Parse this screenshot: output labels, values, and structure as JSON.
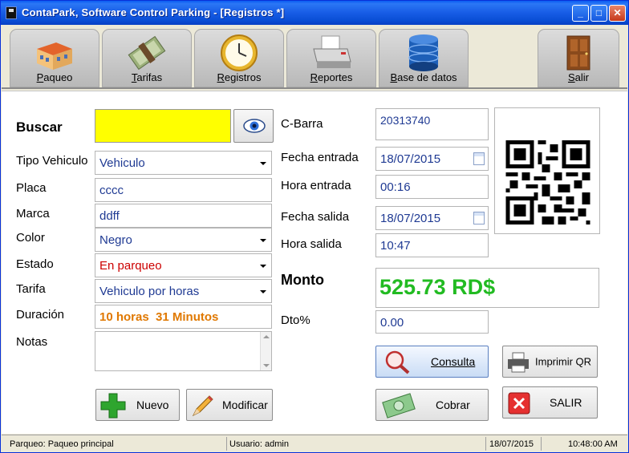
{
  "window": {
    "title": "ContaPark, Software Control Parking - [Registros *]"
  },
  "toolbar": {
    "items": [
      {
        "label": "Paqueo",
        "icon": "building-icon"
      },
      {
        "label": "Tarifas",
        "icon": "money-icon"
      },
      {
        "label": "Registros",
        "icon": "clock-icon"
      },
      {
        "label": "Reportes",
        "icon": "printer-icon"
      },
      {
        "label": "Base de datos",
        "icon": "database-icon"
      },
      {
        "label": "Salir",
        "icon": "door-icon"
      }
    ]
  },
  "form": {
    "buscar_label": "Buscar",
    "tipo_label": "Tipo Vehiculo",
    "tipo_value": "Vehiculo",
    "placa_label": "Placa",
    "placa_value": "cccc",
    "marca_label": "Marca",
    "marca_value": "ddff",
    "color_label": "Color",
    "color_value": "Negro",
    "estado_label": "Estado",
    "estado_value": "En parqueo",
    "tarifa_label": "Tarifa",
    "tarifa_value": "Vehiculo por horas",
    "duracion_label": "Duración",
    "duracion_value": "10 horas  31 Minutos",
    "notas_label": "Notas",
    "cbarra_label": "C-Barra",
    "cbarra_value": "20313740",
    "fecha_entrada_label": "Fecha entrada",
    "fecha_entrada_value": "18/07/2015",
    "hora_entrada_label": "Hora entrada",
    "hora_entrada_value": "00:16",
    "fecha_salida_label": "Fecha salida",
    "fecha_salida_value": "18/07/2015",
    "hora_salida_label": "Hora salida",
    "hora_salida_value": "10:47",
    "monto_label": "Monto",
    "monto_value": "525.73 RD$",
    "dto_label": "Dto%",
    "dto_value": "0.00"
  },
  "buttons": {
    "nuevo": "Nuevo",
    "modificar": "Modificar",
    "consulta": "Consulta",
    "imprimir": "Imprimir QR",
    "cobrar": "Cobrar",
    "salir": "SALIR"
  },
  "status": {
    "parqueo": "Parqueo: Paqueo principal",
    "usuario": "Usuario:  admin",
    "fecha": "18/07/2015",
    "hora": "10:48:00 AM"
  },
  "colors": {
    "titlebar": "#0a4fd6",
    "search_bg": "#ffff00",
    "estado_text": "#cc0000",
    "duracion_text": "#e07800",
    "monto_text": "#22bb22"
  }
}
